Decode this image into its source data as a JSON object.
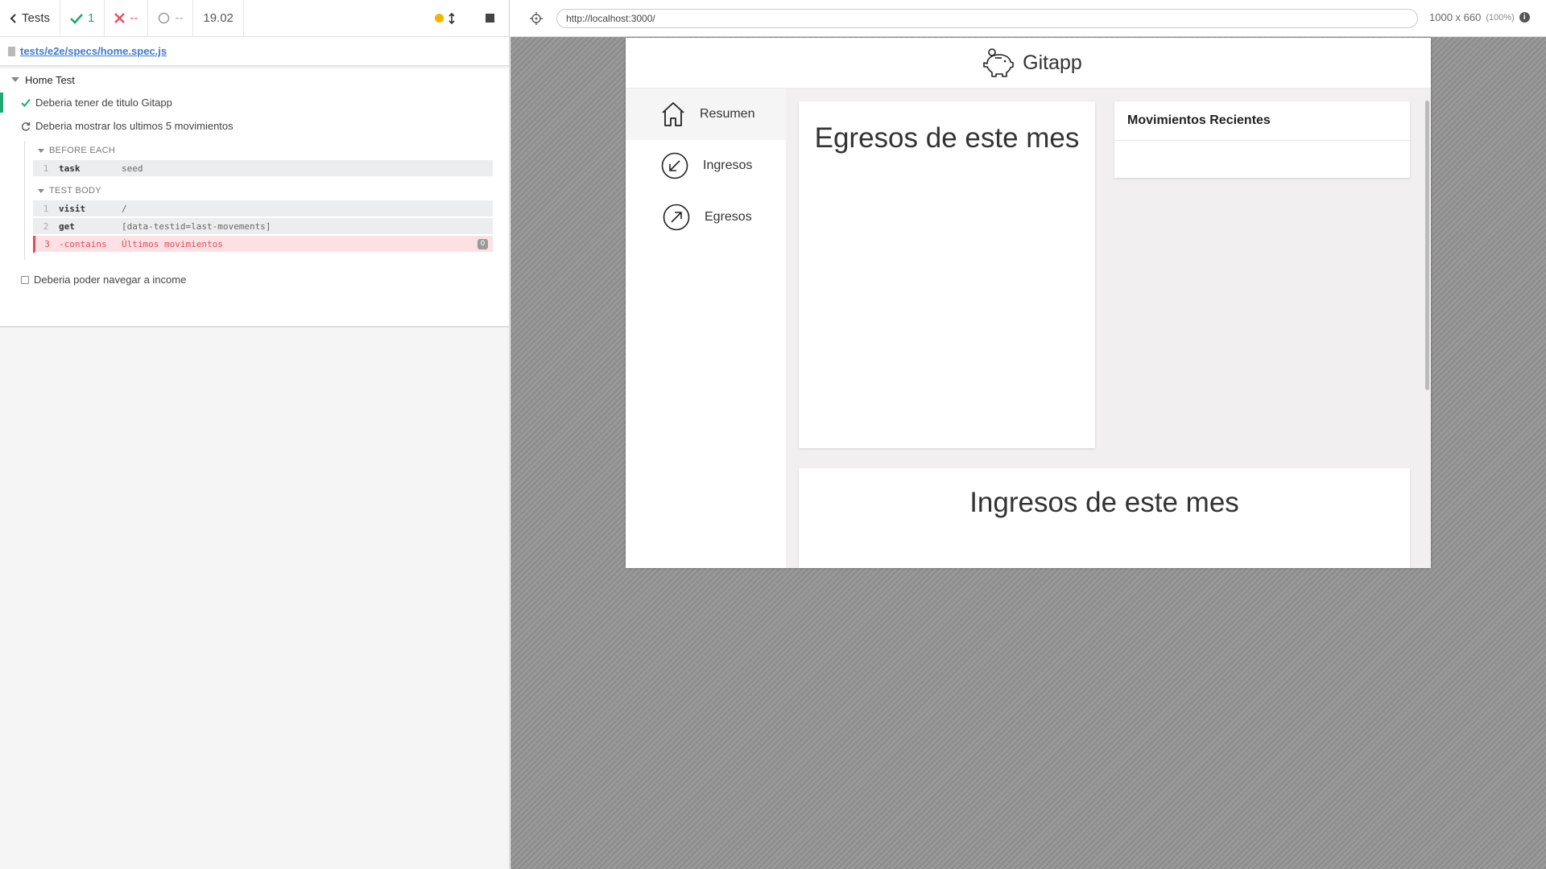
{
  "reporter": {
    "header": {
      "tests_label": "Tests",
      "passed_count": "1",
      "failed_count": "--",
      "pending_count": "--",
      "duration": "19.02"
    },
    "spec_path": "tests/e2e/specs/home.spec.js",
    "suite": {
      "title": "Home Test",
      "tests": [
        {
          "title": "Deberia tener de titulo Gitapp",
          "state": "passed"
        },
        {
          "title": "Deberia mostrar los ultimos 5 movimientos",
          "state": "running"
        },
        {
          "title": "Deberia poder navegar a income",
          "state": "pending"
        }
      ]
    },
    "before_each": {
      "label": "BEFORE EACH",
      "commands": [
        {
          "num": "1",
          "name": "task",
          "message": "seed"
        }
      ]
    },
    "test_body": {
      "label": "TEST BODY",
      "commands": [
        {
          "num": "1",
          "name": "visit",
          "message": "/"
        },
        {
          "num": "2",
          "name": "get",
          "message": "[data-testid=last-movements]"
        },
        {
          "num": "3",
          "name": "-contains",
          "message": "Últimos movimientos",
          "badge": "0"
        }
      ]
    }
  },
  "aut": {
    "url": "http://localhost:3000/",
    "viewport": "1000 x 660",
    "zoom": "(100%)",
    "app": {
      "title": "Gitapp",
      "nav": [
        {
          "label": "Resumen",
          "icon": "home-icon",
          "active": true
        },
        {
          "label": "Ingresos",
          "icon": "arrow-down-left-icon",
          "active": false
        },
        {
          "label": "Egresos",
          "icon": "arrow-up-right-icon",
          "active": false
        }
      ],
      "egresos_title": "Egresos de este mes",
      "movimientos_title": "Movimientos Recientes",
      "ingresos_title": "Ingresos de este mes"
    }
  },
  "colors": {
    "passed": "#1fa971",
    "failed": "#e94f5f",
    "link": "#3a7bd5",
    "running_dot": "#f4b400"
  }
}
